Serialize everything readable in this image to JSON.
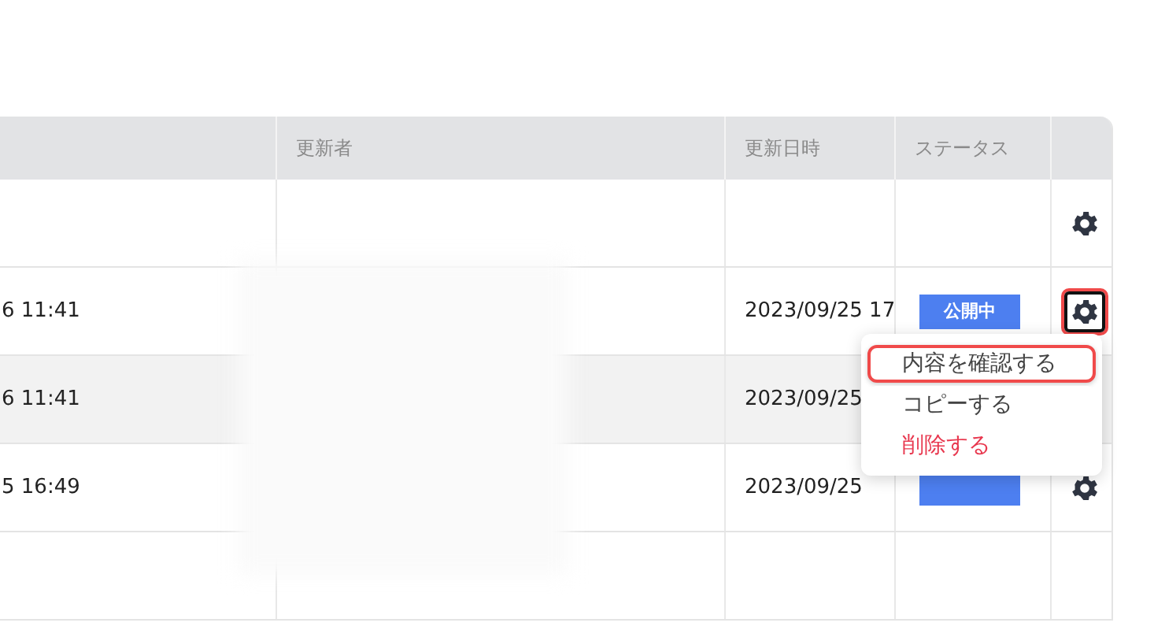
{
  "table": {
    "columns": [
      "",
      "更新者",
      "更新日時",
      "ステータス",
      ""
    ],
    "rows": [
      {
        "col1": "",
        "date": "",
        "gear": true,
        "shaded": false
      },
      {
        "col1": "6 11:41",
        "date": "2023/09/25 17",
        "status": "公開中",
        "gear": true,
        "gear_highlighted": true,
        "shaded": false
      },
      {
        "col1": "6 11:41",
        "date": "2023/09/25",
        "shaded": true
      },
      {
        "col1": "5 16:49",
        "date": "2023/09/25",
        "status": "",
        "gear": true,
        "shaded": false
      },
      {
        "col1": "",
        "date": "",
        "shaded": false
      }
    ]
  },
  "menu": {
    "items": [
      {
        "label": "内容を確認する",
        "kind": "normal",
        "highlighted": true
      },
      {
        "label": "コピーする",
        "kind": "normal",
        "highlighted": false
      },
      {
        "label": "削除する",
        "kind": "danger",
        "highlighted": false
      }
    ]
  }
}
